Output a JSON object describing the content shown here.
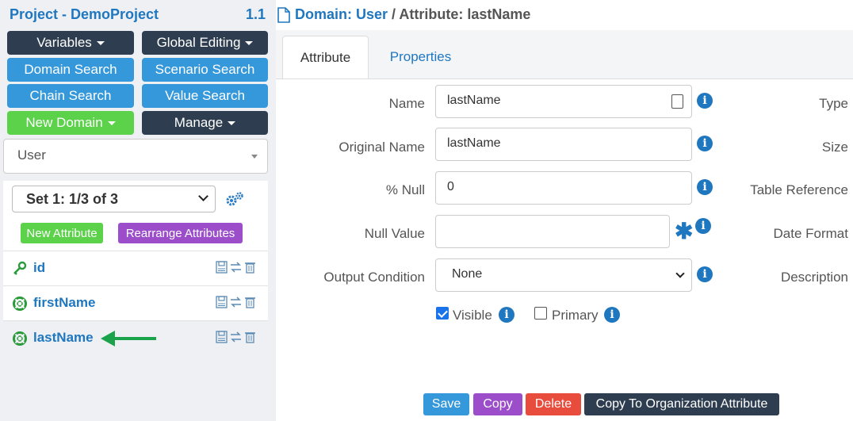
{
  "project": {
    "title": "Project - DemoProject",
    "version": "1.1"
  },
  "nav": {
    "variables": "Variables",
    "global_editing": "Global Editing",
    "domain_search": "Domain Search",
    "scenario_search": "Scenario Search",
    "chain_search": "Chain Search",
    "value_search": "Value Search",
    "new_domain": "New Domain",
    "manage": "Manage"
  },
  "domain_select": {
    "value": "User"
  },
  "set_select": {
    "value": "Set 1: 1/3 of 3"
  },
  "attr_buttons": {
    "new": "New Attribute",
    "rearrange": "Rearrange Attributes"
  },
  "attributes": [
    {
      "name": "id",
      "icon": "key-icon"
    },
    {
      "name": "firstName",
      "icon": "lifebuoy-icon"
    },
    {
      "name": "lastName",
      "icon": "lifebuoy-icon",
      "selected": true
    }
  ],
  "breadcrumb": {
    "domain_link": "Domain: User",
    "rest": " / Attribute: lastName"
  },
  "tabs": {
    "attribute": "Attribute",
    "properties": "Properties"
  },
  "form": {
    "name_label": "Name",
    "name_value": "lastName",
    "original_name_label": "Original Name",
    "original_name_value": "lastName",
    "null_pct_label": "% Null",
    "null_pct_value": "0",
    "null_value_label": "Null Value",
    "null_value_value": "",
    "output_condition_label": "Output Condition",
    "output_condition_value": "None",
    "visible_label": "Visible",
    "visible_checked": true,
    "primary_label": "Primary",
    "primary_checked": false
  },
  "right_labels": {
    "type": "Type",
    "size": "Size",
    "table_reference": "Table Reference",
    "date_format": "Date Format",
    "description": "Description"
  },
  "actions": {
    "save": "Save",
    "copy": "Copy",
    "delete": "Delete",
    "copy_to_org": "Copy To Organization Attribute"
  },
  "colors": {
    "accent": "#1f77c0",
    "dark": "#2e3e50",
    "blue": "#3498db",
    "green": "#5bd24a",
    "purple": "#9b4dca",
    "red": "#e74c3c",
    "arrow_green": "#1aa34a"
  }
}
